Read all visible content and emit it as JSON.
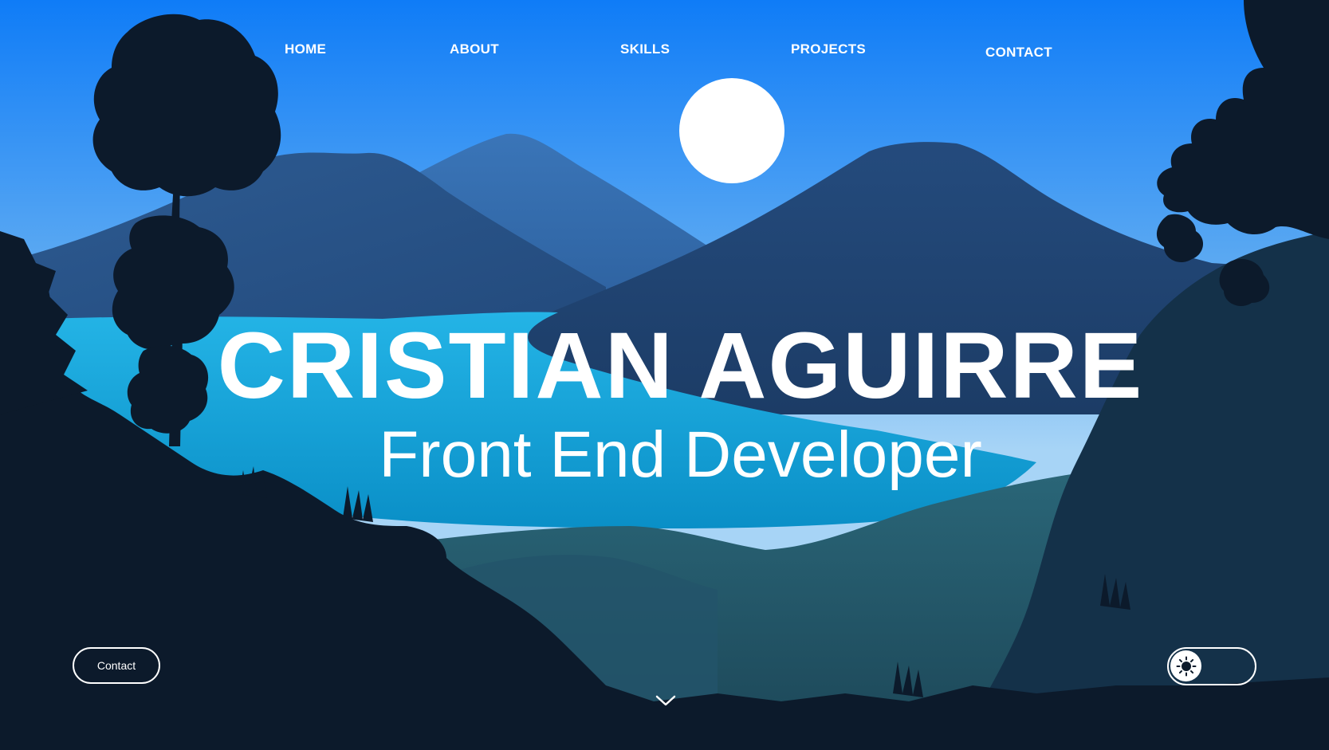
{
  "nav": {
    "items": [
      {
        "label": "HOME"
      },
      {
        "label": "ABOUT"
      },
      {
        "label": "SKILLS"
      },
      {
        "label": "PROJECTS"
      },
      {
        "label": "CONTACT"
      }
    ]
  },
  "hero": {
    "name": "CRISTIAN AGUIRRE",
    "role": "Front End Developer"
  },
  "contact_button": {
    "label": "Contact"
  },
  "theme_toggle": {
    "icon": "sun-icon",
    "state": "light"
  },
  "scroll_indicator": {
    "icon": "chevron-down-icon"
  },
  "colors": {
    "sky_top": "#0f7cf7",
    "sky_bottom": "#9dd0f5",
    "moon": "#ffffff",
    "lake": "#1ea6d8",
    "foreground": "#0c1a2b",
    "text": "#ffffff"
  }
}
